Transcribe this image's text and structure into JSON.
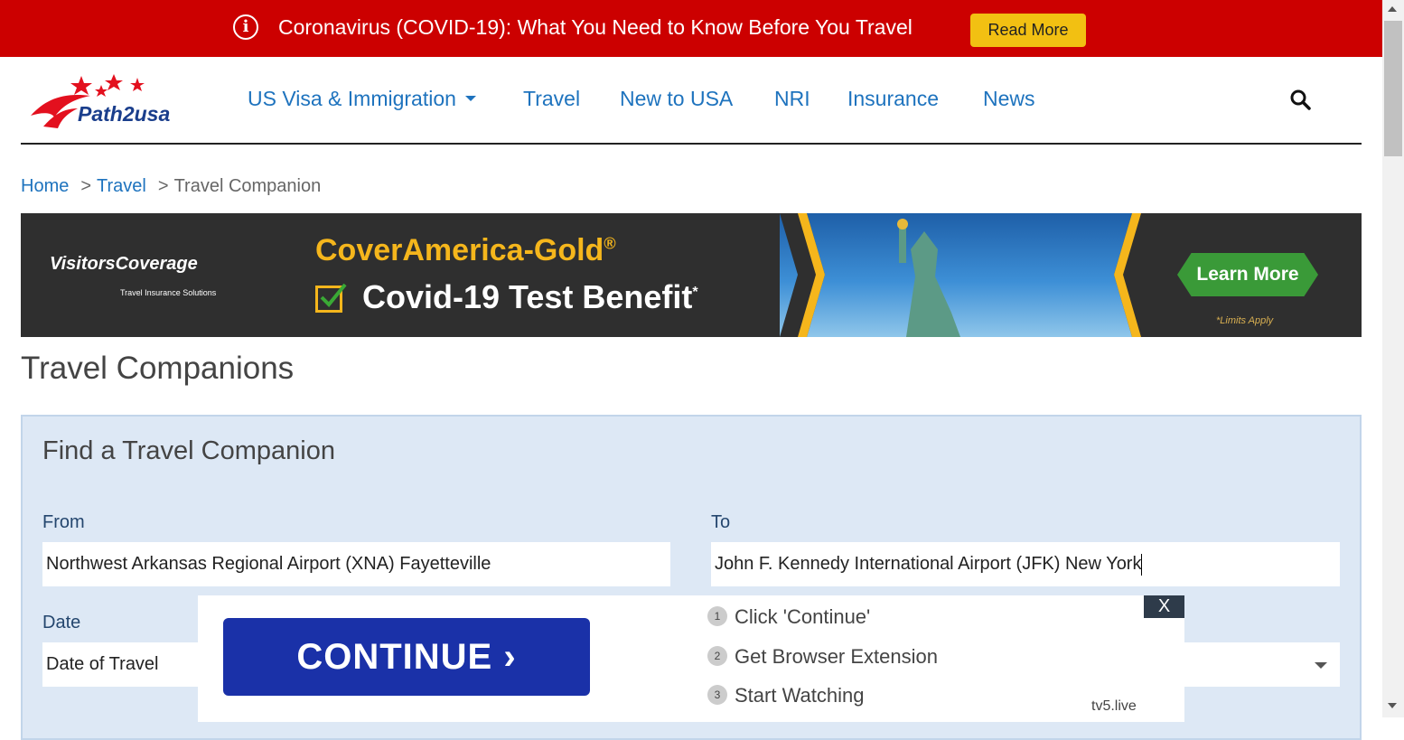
{
  "alert": {
    "text": "Coronavirus (COVID-19): What You Need to Know Before You Travel",
    "button": "Read More"
  },
  "header": {
    "logo_text": "Path2usa",
    "nav": [
      "US Visa & Immigration",
      "Travel",
      "New to USA",
      "NRI",
      "Insurance",
      "News"
    ],
    "search_icon": "search-icon"
  },
  "breadcrumb": {
    "home": "Home",
    "travel": "Travel",
    "current": "Travel Companion",
    "separator": ">"
  },
  "ad_banner": {
    "brand": "VisitorsCoverage",
    "brand_sub": "Travel Insurance Solutions",
    "title": "CoverAmerica-Gold",
    "title_mark": "®",
    "benefit": "Covid-19 Test Benefit",
    "benefit_mark": "*",
    "cta": "Learn More",
    "note": "*Limits Apply"
  },
  "page_title": "Travel Companions",
  "form": {
    "title": "Find a Travel Companion",
    "from_label": "From",
    "from_value": "Northwest Arkansas Regional Airport (XNA) Fayetteville",
    "to_label": "To",
    "to_value": "John F. Kennedy International Airport (JFK) New York",
    "date_label": "Date",
    "date_value": "Date of Travel"
  },
  "popup_ad": {
    "close": "X",
    "button": "CONTINUE ›",
    "steps": [
      {
        "num": "1",
        "text": "Click 'Continue'"
      },
      {
        "num": "2",
        "text": "Get Browser Extension"
      },
      {
        "num": "3",
        "text": "Start Watching"
      }
    ],
    "source": "tv5.live"
  },
  "colors": {
    "alert_bg": "#cc0000",
    "nav_link": "#1e73be",
    "panel_bg": "#dde8f5",
    "continue_bg": "#1a31a8"
  }
}
